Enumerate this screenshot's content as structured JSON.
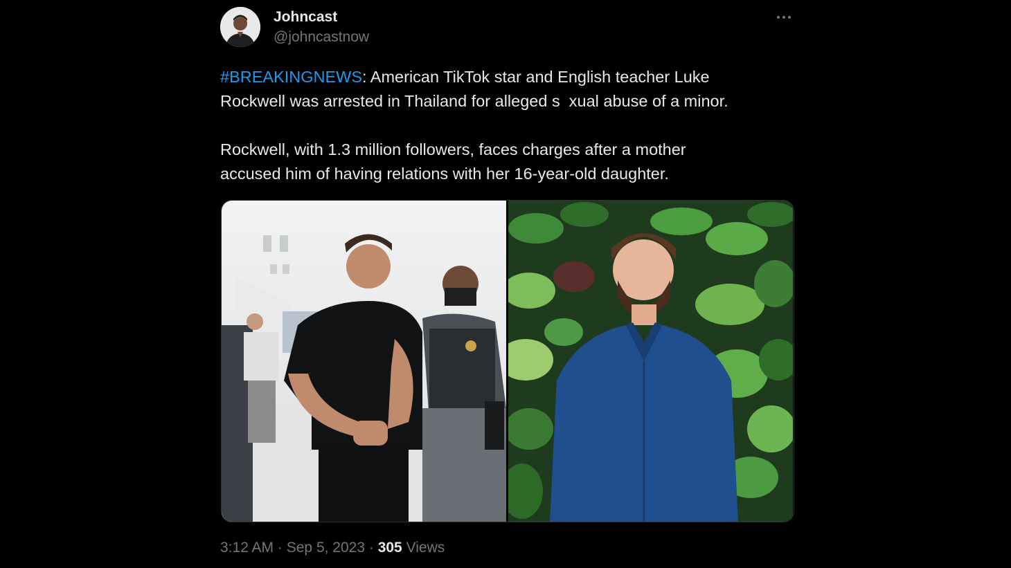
{
  "author": {
    "name": "Johncast",
    "handle": "@johncastnow"
  },
  "tweet": {
    "hashtag": "#BREAKINGNEWS",
    "line1_rest": ": American TikTok star and English teacher Luke",
    "line2": "Rockwell was arrested in Thailand for alleged s  xual abuse of a minor.",
    "line3": "Rockwell, with 1.3 million followers, faces charges after a mother",
    "line4": "accused him of having relations with her 16-year-old daughter."
  },
  "media": {
    "photos": [
      "arrest-photo",
      "portrait-photo"
    ]
  },
  "meta": {
    "time": "3:12 AM",
    "separator": "·",
    "date": "Sep 5, 2023",
    "views_count": "305",
    "views_label": "Views"
  },
  "icons": {
    "more": "more-options-icon"
  },
  "colors": {
    "background": "#000000",
    "text": "#e7e9ea",
    "secondary": "#71767b",
    "link": "#1d9bf0"
  }
}
